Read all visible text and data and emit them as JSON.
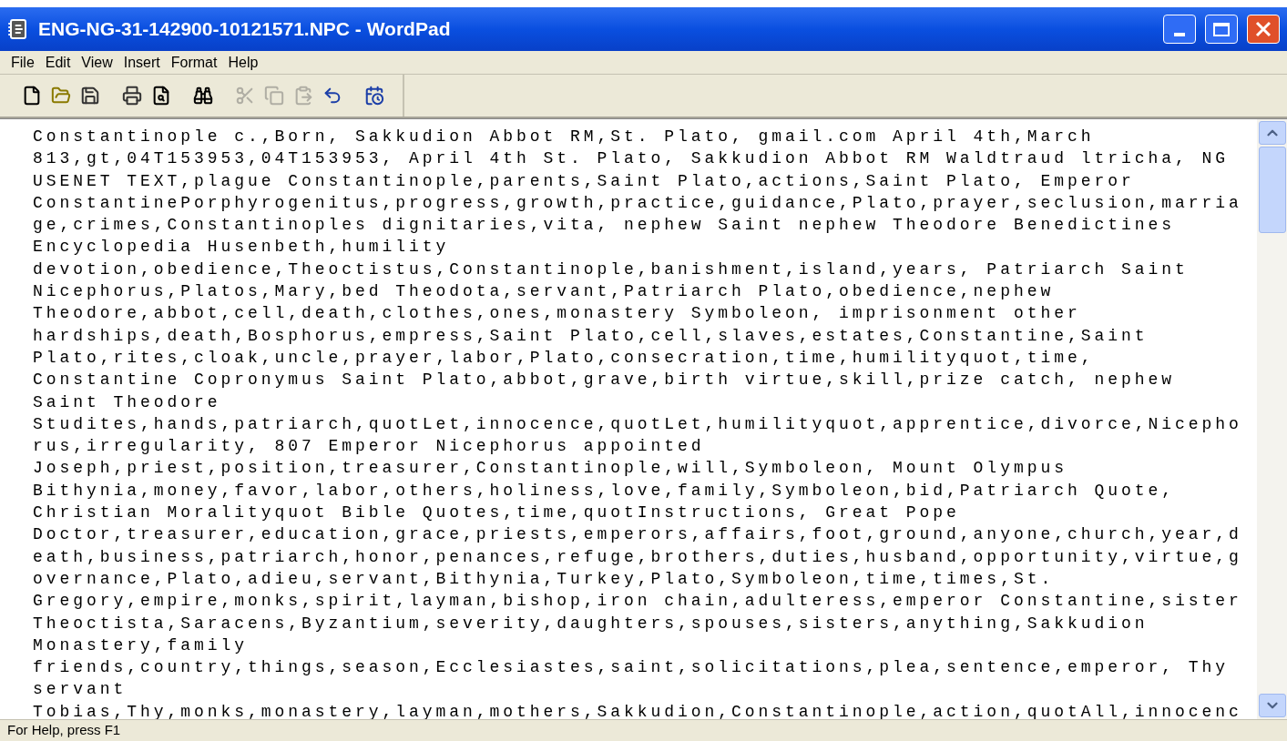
{
  "window": {
    "title": "ENG-NG-31-142900-10121571.NPC - WordPad"
  },
  "menu": [
    "File",
    "Edit",
    "View",
    "Insert",
    "Format",
    "Help"
  ],
  "toolbar": [
    {
      "kind": "new",
      "disabled": false
    },
    {
      "kind": "open",
      "disabled": false
    },
    {
      "kind": "save",
      "disabled": false
    },
    {
      "kind": "print",
      "disabled": false
    },
    {
      "kind": "preview",
      "disabled": false
    },
    {
      "kind": "find",
      "disabled": false
    },
    {
      "kind": "cut",
      "disabled": true
    },
    {
      "kind": "copy",
      "disabled": true
    },
    {
      "kind": "paste",
      "disabled": true
    },
    {
      "kind": "undo",
      "disabled": false
    },
    {
      "kind": "datetime",
      "disabled": false
    }
  ],
  "document": {
    "lines": [
      "Constantinople c.,Born, Sakkudion Abbot RM,St. Plato, gmail.com April 4th,March",
      "813,gt,04T153953,04T153953, April 4th St. Plato, Sakkudion Abbot RM Waldtraud ltricha, NG",
      "USENET TEXT,plague Constantinople,parents,Saint Plato,actions,Saint Plato, Emperor",
      "ConstantinePorphyrogenitus,progress,growth,practice,guidance,Plato,prayer,seclusion,marria",
      "ge,crimes,Constantinoples dignitaries,vita, nephew Saint nephew Theodore Benedictines",
      "Encyclopedia Husenbeth,humility",
      "devotion,obedience,Theoctistus,Constantinople,banishment,island,years, Patriarch Saint",
      "Nicephorus,Platos,Mary,bed Theodota,servant,Patriarch Plato,obedience,nephew",
      "Theodore,abbot,cell,death,clothes,ones,monastery Symboleon, imprisonment other",
      "hardships,death,Bosphorus,empress,Saint Plato,cell,slaves,estates,Constantine,Saint",
      "Plato,rites,cloak,uncle,prayer,labor,Plato,consecration,time,humilityquot,time,",
      "Constantine Copronymus Saint Plato,abbot,grave,birth virtue,skill,prize catch, nephew",
      "Saint Theodore",
      "Studites,hands,patriarch,quotLet,innocence,quotLet,humilityquot,apprentice,divorce,Nicepho",
      "rus,irregularity, 807 Emperor Nicephorus appointed",
      "Joseph,priest,position,treasurer,Constantinople,will,Symboleon, Mount Olympus",
      "Bithynia,money,favor,labor,others,holiness,love,family,Symboleon,bid,Patriarch Quote,",
      "Christian Moralityquot Bible Quotes,time,quotInstructions, Great Pope",
      "Doctor,treasurer,education,grace,priests,emperors,affairs,foot,ground,anyone,church,year,d",
      "eath,business,patriarch,honor,penances,refuge,brothers,duties,husband,opportunity,virtue,g",
      "overnance,Plato,adieu,servant,Bithynia,Turkey,Plato,Symboleon,time,times,St.",
      "Gregory,empire,monks,spirit,layman,bishop,iron chain,adulteress,emperor Constantine,sister",
      "Theoctista,Saracens,Byzantium,severity,daughters,spouses,sisters,anything,Sakkudion",
      "Monastery,family",
      "friends,country,things,season,Ecclesiastes,saint,solicitations,plea,sentence,emperor, Thy",
      "servant",
      "Tobias,Thy,monks,monastery,layman,mothers,Sakkudion,Constantinople,action,quotAll,innocenc"
    ]
  },
  "status_bar": {
    "text": "For Help, press F1"
  }
}
